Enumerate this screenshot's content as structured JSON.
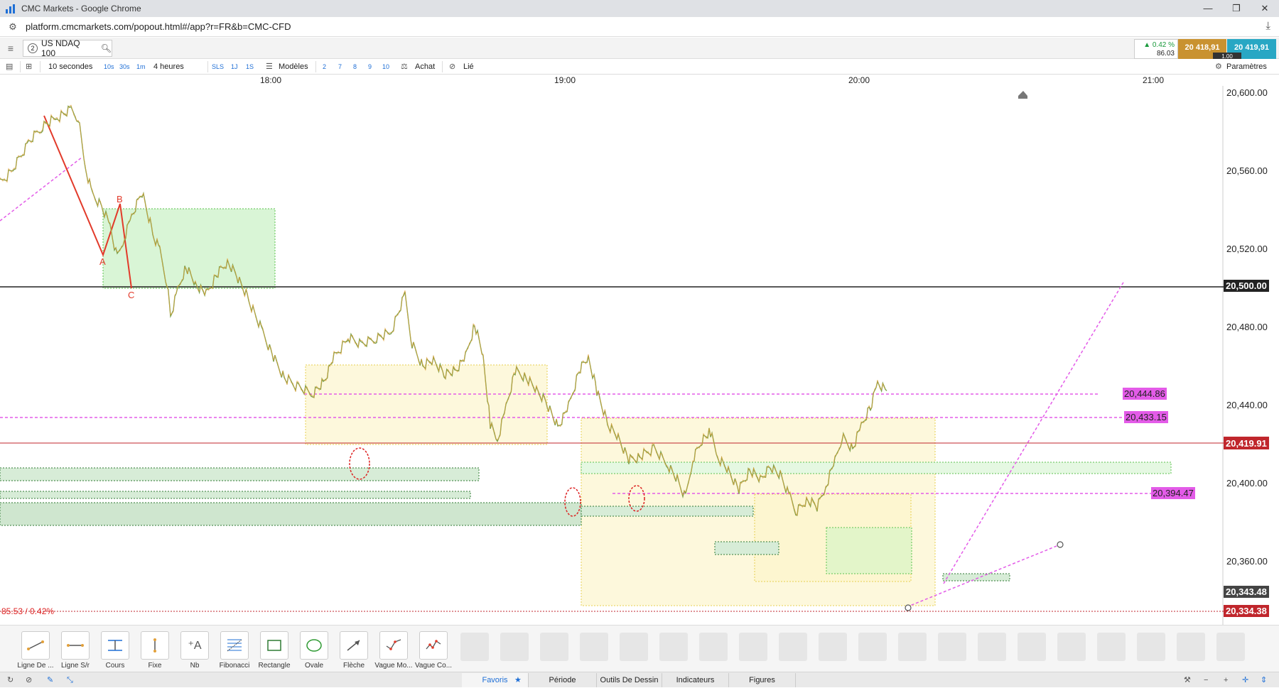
{
  "window": {
    "title": "CMC Markets - Google Chrome"
  },
  "browser": {
    "url": "platform.cmcmarkets.com/popout.html#/app?r=FR&b=CMC-CFD"
  },
  "instrument": {
    "tab_number": "2",
    "name": "US NDAQ 100",
    "change_pct": "▲ 0.42 %",
    "change_pts": "86.03",
    "sell": "20 418,91",
    "buy": "20 419,91",
    "spread": "1.00"
  },
  "toolbar": {
    "interval": "10 secondes",
    "int_10s": "10s",
    "int_30s": "30s",
    "int_1m": "1m",
    "range": "4 heures",
    "sls": "SLS",
    "r1j": "1J",
    "r1s": "1S",
    "templates": "Modèles",
    "n2": "2",
    "n7": "7",
    "n8": "8",
    "n9": "9",
    "n10": "10",
    "buy_label": "Achat",
    "linked": "Lié",
    "settings": "Paramètres"
  },
  "time_axis": {
    "labels": [
      "18:00",
      "19:00",
      "20:00",
      "21:00"
    ]
  },
  "price_axis": {
    "labels": [
      "20,600.00",
      "20,560.00",
      "20,520.00",
      "20,480.00",
      "20,440.00",
      "20,400.00",
      "20,360.00"
    ]
  },
  "chart_data": {
    "type": "line",
    "ylim": [
      20330,
      20605
    ],
    "x_ticks": [
      "18:00",
      "19:00",
      "20:00",
      "21:00"
    ],
    "y_ticks": [
      20600,
      20560,
      20520,
      20480,
      20440,
      20400,
      20360
    ],
    "current_price": "20,419.91",
    "low_price": "20,343.48",
    "other_price": "20,334.38",
    "level_20500": "20,500.00",
    "dashed_levels": [
      "20,444.86",
      "20,433.15",
      "20,394.47"
    ],
    "wave_labels": [
      "A",
      "B",
      "C"
    ],
    "change_note": "85.53 / 0.42%",
    "price_path_points": [
      [
        0,
        20545
      ],
      [
        20,
        20555
      ],
      [
        40,
        20570
      ],
      [
        60,
        20580
      ],
      [
        80,
        20585
      ],
      [
        100,
        20590
      ],
      [
        110,
        20585
      ],
      [
        120,
        20555
      ],
      [
        130,
        20538
      ],
      [
        145,
        20530
      ],
      [
        155,
        20520
      ],
      [
        165,
        20500
      ],
      [
        175,
        20512
      ],
      [
        185,
        20525
      ],
      [
        200,
        20540
      ],
      [
        215,
        20515
      ],
      [
        225,
        20505
      ],
      [
        235,
        20485
      ],
      [
        240,
        20465
      ],
      [
        250,
        20480
      ],
      [
        262,
        20495
      ],
      [
        275,
        20485
      ],
      [
        290,
        20478
      ],
      [
        305,
        20490
      ],
      [
        320,
        20498
      ],
      [
        335,
        20488
      ],
      [
        350,
        20475
      ],
      [
        370,
        20455
      ],
      [
        385,
        20440
      ],
      [
        400,
        20428
      ],
      [
        420,
        20422
      ],
      [
        440,
        20418
      ],
      [
        455,
        20425
      ],
      [
        470,
        20440
      ],
      [
        490,
        20452
      ],
      [
        510,
        20448
      ],
      [
        530,
        20452
      ],
      [
        550,
        20455
      ],
      [
        570,
        20478
      ],
      [
        580,
        20448
      ],
      [
        595,
        20435
      ],
      [
        610,
        20438
      ],
      [
        625,
        20430
      ],
      [
        640,
        20432
      ],
      [
        655,
        20440
      ],
      [
        668,
        20460
      ],
      [
        680,
        20440
      ],
      [
        690,
        20400
      ],
      [
        700,
        20390
      ],
      [
        712,
        20410
      ],
      [
        725,
        20432
      ],
      [
        740,
        20428
      ],
      [
        755,
        20420
      ],
      [
        770,
        20412
      ],
      [
        785,
        20398
      ],
      [
        800,
        20410
      ],
      [
        815,
        20432
      ],
      [
        828,
        20440
      ],
      [
        840,
        20420
      ],
      [
        855,
        20400
      ],
      [
        870,
        20392
      ],
      [
        885,
        20378
      ],
      [
        900,
        20380
      ],
      [
        920,
        20385
      ],
      [
        940,
        20375
      ],
      [
        955,
        20365
      ],
      [
        965,
        20355
      ],
      [
        975,
        20378
      ],
      [
        990,
        20392
      ],
      [
        1000,
        20395
      ],
      [
        1010,
        20380
      ],
      [
        1025,
        20372
      ],
      [
        1040,
        20360
      ],
      [
        1055,
        20372
      ],
      [
        1070,
        20366
      ],
      [
        1085,
        20374
      ],
      [
        1100,
        20368
      ],
      [
        1112,
        20355
      ],
      [
        1120,
        20346
      ],
      [
        1135,
        20354
      ],
      [
        1150,
        20350
      ],
      [
        1162,
        20362
      ],
      [
        1175,
        20378
      ],
      [
        1185,
        20392
      ],
      [
        1200,
        20385
      ],
      [
        1212,
        20398
      ],
      [
        1225,
        20410
      ],
      [
        1235,
        20425
      ],
      [
        1248,
        20420
      ]
    ]
  },
  "drawing_tools": [
    {
      "label": "Ligne De ...",
      "icon": "trend-line-icon"
    },
    {
      "label": "Ligne S/r",
      "icon": "sr-line-icon"
    },
    {
      "label": "Cours",
      "icon": "price-icon"
    },
    {
      "label": "Fixe",
      "icon": "fixed-icon"
    },
    {
      "label": "Nb",
      "icon": "text-icon"
    },
    {
      "label": "Fibonacci",
      "icon": "fibonacci-icon"
    },
    {
      "label": "Rectangle",
      "icon": "rectangle-icon"
    },
    {
      "label": "Ovale",
      "icon": "oval-icon"
    },
    {
      "label": "Flèche",
      "icon": "arrow-icon"
    },
    {
      "label": "Vague Mo...",
      "icon": "wave-icon"
    },
    {
      "label": "Vague Co...",
      "icon": "wave-complex-icon"
    }
  ],
  "footer": {
    "favoris": "Favoris",
    "periode": "Période",
    "outils": "Outils De Dessin",
    "indicateurs": "Indicateurs",
    "figures": "Figures"
  }
}
